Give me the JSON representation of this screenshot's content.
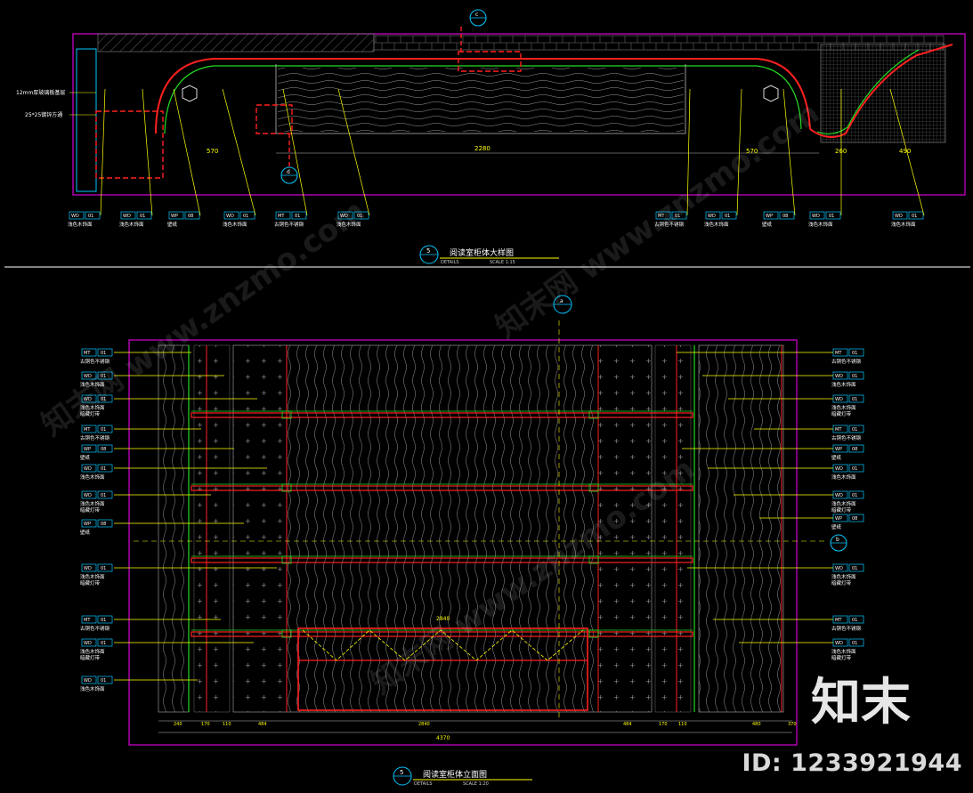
{
  "drawing_top": {
    "title": "阅读室柜体大样图",
    "number": "5",
    "subtitle": "DETAILS",
    "scale": "SCALE 1:15",
    "left_notes": [
      "12mm厚玻璃板基层",
      "25*25镀锌方通"
    ],
    "dims": [
      "2280",
      "570",
      "570",
      "260",
      "490",
      "270",
      "1000"
    ],
    "tags": [
      {
        "code": "WD",
        "num": "01",
        "text": "浅色木饰面"
      },
      {
        "code": "WD",
        "num": "01",
        "text": "浅色木饰面"
      },
      {
        "code": "WP",
        "num": "08",
        "text": "壁纸"
      },
      {
        "code": "WD",
        "num": "01",
        "text": "浅色木饰面"
      },
      {
        "code": "MT",
        "num": "01",
        "text": "古铜色不锈钢"
      },
      {
        "code": "WD",
        "num": "01",
        "text": "浅色木饰面"
      },
      {
        "code": "MT",
        "num": "01",
        "text": "古铜色不锈钢"
      },
      {
        "code": "WD",
        "num": "01",
        "text": "浅色木饰面"
      },
      {
        "code": "WP",
        "num": "08",
        "text": "壁纸"
      },
      {
        "code": "WD",
        "num": "01",
        "text": "浅色木饰面"
      },
      {
        "code": "WD",
        "num": "01",
        "text": "浅色木饰面"
      }
    ],
    "callouts": [
      "c",
      "d"
    ]
  },
  "drawing_bottom": {
    "title": "阅读室柜体立面图",
    "number": "5",
    "subtitle": "DETAILS",
    "scale": "SCALE 1:20",
    "total_width": "4370",
    "inner_width": "2840",
    "bottom_dims": [
      "240",
      "170",
      "110",
      "484",
      "2840",
      "484",
      "170",
      "110",
      "480",
      "370"
    ],
    "left_tags": [
      {
        "code": "MT",
        "num": "01",
        "text": "古铜色不锈钢"
      },
      {
        "code": "WD",
        "num": "01",
        "text": "浅色木饰面"
      },
      {
        "code": "WD",
        "num": "01",
        "text": "浅色木饰面",
        "text2": "暗藏灯带"
      },
      {
        "code": "MT",
        "num": "01",
        "text": "古铜色不锈钢"
      },
      {
        "code": "WP",
        "num": "08",
        "text": "壁纸"
      },
      {
        "code": "WD",
        "num": "01",
        "text": "浅色木饰面"
      },
      {
        "code": "WD",
        "num": "01",
        "text": "浅色木饰面",
        "text2": "暗藏灯带"
      },
      {
        "code": "WP",
        "num": "08",
        "text": "壁纸"
      },
      {
        "code": "WD",
        "num": "01",
        "text": "浅色木饰面",
        "text2": "暗藏灯带"
      },
      {
        "code": "MT",
        "num": "01",
        "text": "古铜色不锈钢"
      },
      {
        "code": "WD",
        "num": "01",
        "text": "浅色木饰面",
        "text2": "暗藏灯带"
      },
      {
        "code": "WD",
        "num": "01",
        "text": "浅色木饰面"
      }
    ],
    "right_tags": [
      {
        "code": "MT",
        "num": "01",
        "text": "古铜色不锈钢"
      },
      {
        "code": "WD",
        "num": "01",
        "text": "浅色木饰面"
      },
      {
        "code": "WD",
        "num": "01",
        "text": "浅色木饰面",
        "text2": "暗藏灯带"
      },
      {
        "code": "MT",
        "num": "01",
        "text": "古铜色不锈钢"
      },
      {
        "code": "WP",
        "num": "08",
        "text": "壁纸"
      },
      {
        "code": "WD",
        "num": "01",
        "text": "浅色木饰面"
      },
      {
        "code": "WD",
        "num": "01",
        "text": "浅色木饰面",
        "text2": "暗藏灯带"
      },
      {
        "code": "WP",
        "num": "08",
        "text": "壁纸"
      },
      {
        "code": "WD",
        "num": "01",
        "text": "浅色木饰面",
        "text2": "暗藏灯带"
      },
      {
        "code": "MT",
        "num": "01",
        "text": "古铜色不锈钢"
      },
      {
        "code": "WD",
        "num": "01",
        "text": "浅色木饰面",
        "text2": "暗藏灯带"
      }
    ],
    "callouts": [
      "a",
      "b"
    ]
  },
  "watermark": {
    "logo": "知末",
    "id": "ID: 1233921944",
    "ghost": "知末网 www.znzmo.com"
  },
  "colors": {
    "background": "#000000",
    "outline": "#ff00ff",
    "red": "#ff2020",
    "green": "#22dd22",
    "yellow": "#ffff00",
    "white": "#ffffff",
    "cyan": "#00c8ff",
    "grey": "#9a9a9a"
  }
}
